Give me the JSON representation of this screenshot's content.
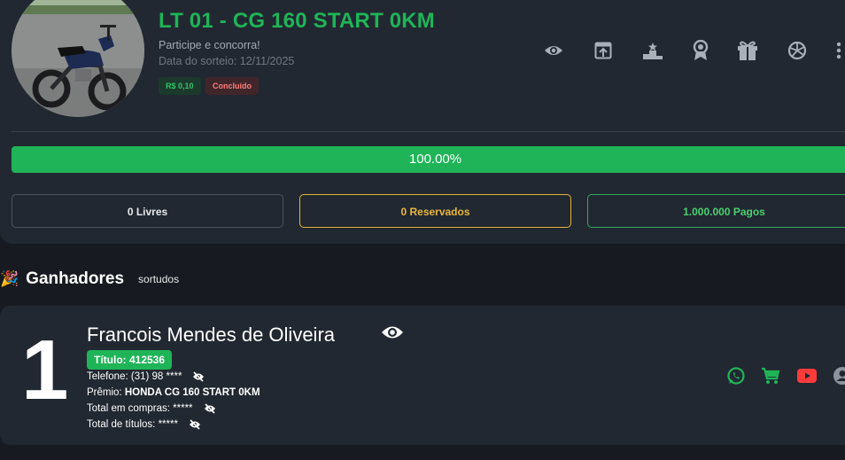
{
  "raffle": {
    "title": "LT 01 - CG 160 START 0KM",
    "subtitle": "Participe e concorra!",
    "draw_date": "Data do sorteio: 12/11/2025",
    "price_badge": "R$ 0,10",
    "status_badge": "Concluído",
    "progress_label": "100.00%",
    "progress_value": 1.0
  },
  "toolbar": {
    "icons": [
      "eye-icon",
      "share-icon",
      "podium-icon",
      "award-icon",
      "gift-icon",
      "spin-icon",
      "more-icon"
    ]
  },
  "stats": {
    "free": "0 Livres",
    "reserved": "0 Reservados",
    "paid": "1.000.000 Pagos"
  },
  "winners": {
    "emoji": "🎉",
    "title": "Ganhadores",
    "subtitle": "sortudos",
    "items": [
      {
        "rank": "1",
        "name": "Francois Mendes de Oliveira",
        "ticket": "Título: 412536",
        "phone_label": "Telefone:",
        "phone_value": "(31) 98 ****",
        "prize_label": "Prêmio:",
        "prize_value": "HONDA CG 160 START 0KM",
        "purchases_label": "Total em compras:",
        "purchases_value": "*****",
        "tickets_label": "Total de títulos:",
        "tickets_value": "*****"
      }
    ]
  },
  "colors": {
    "accent": "#1fb457",
    "reserved": "#e8b63d",
    "danger": "#ff5a5a",
    "background": "#171b21",
    "card": "#222831"
  }
}
